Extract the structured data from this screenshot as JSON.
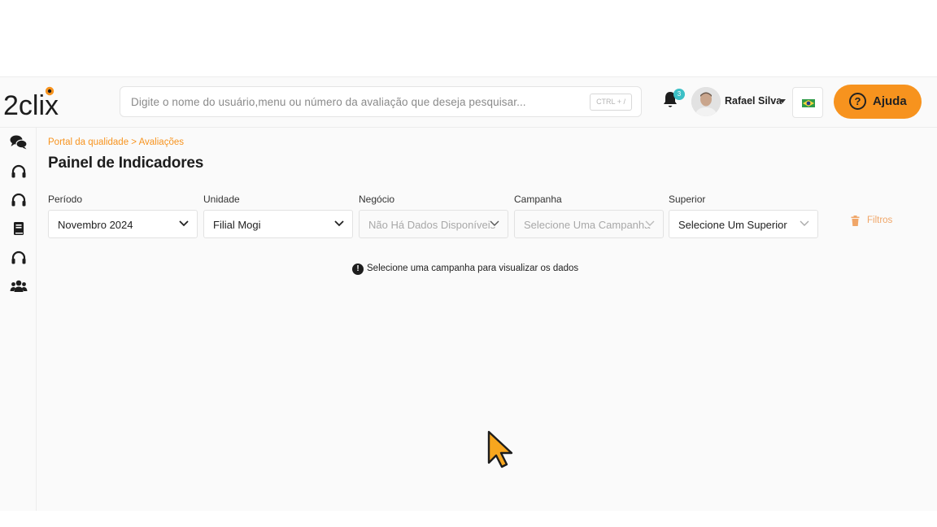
{
  "header": {
    "logo_text": "2clix",
    "search_placeholder": "Digite o nome do usuário,menu ou número da avaliação que deseja pesquisar...",
    "search_shortcut": "CTRL + /",
    "notification_count": "3",
    "user_name": "Rafael Silva",
    "help_label": "Ajuda",
    "help_icon": "?"
  },
  "sidebar": {
    "items": [
      {
        "icon": "chat-icon"
      },
      {
        "icon": "headset-icon"
      },
      {
        "icon": "headset-icon"
      },
      {
        "icon": "book-icon"
      },
      {
        "icon": "headset-icon"
      },
      {
        "icon": "users-icon"
      }
    ]
  },
  "page": {
    "breadcrumb": "Portal da qualidade > Avaliações",
    "title": "Painel de Indicadores"
  },
  "filters": [
    {
      "label": "Período",
      "value": "Novembro 2024",
      "disabled": false
    },
    {
      "label": "Unidade",
      "value": "Filial Mogi",
      "disabled": false
    },
    {
      "label": "Negócio",
      "value": "Não Há Dados Disponíveis",
      "disabled": true
    },
    {
      "label": "Campanha",
      "value": "Selecione Uma Campanha",
      "disabled": true
    },
    {
      "label": "Superior",
      "value": "Selecione Um Superior",
      "disabled": false
    }
  ],
  "filters_button_label": "Filtros",
  "notice": {
    "icon": "!",
    "text": "Selecione uma campanha para visualizar os dados"
  },
  "colors": {
    "accent": "#f7931e",
    "badge": "#3cc0c6"
  }
}
